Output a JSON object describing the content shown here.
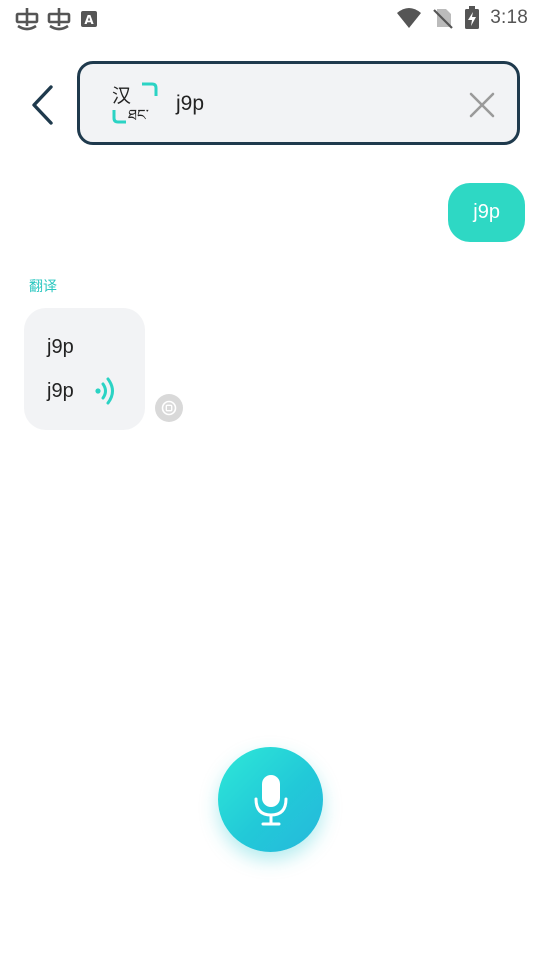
{
  "status_bar": {
    "time": "3:18",
    "left_icons": [
      "bug-icon",
      "bug-icon",
      "a-font-icon"
    ],
    "right_icons": [
      "wifi-icon",
      "no-sim-icon",
      "battery-charging-icon"
    ]
  },
  "header": {
    "back_icon": "chevron-left-icon",
    "search": {
      "value": "j9p",
      "logo_text": "汉",
      "logo_script": "ཐང་",
      "clear_icon": "close-icon"
    }
  },
  "chat": {
    "user_message": "j9p",
    "translate_label": "翻译",
    "reply": {
      "line1": "j9p",
      "line2": "j9p",
      "speaker_icon": "sound-wave-icon",
      "copy_icon": "copy-icon"
    }
  },
  "mic": {
    "icon": "microphone-icon"
  },
  "colors": {
    "accent": "#2ed8c4",
    "border": "#1f3a4d",
    "bubble_bg": "#f2f3f5",
    "label": "#2bc7c0"
  }
}
